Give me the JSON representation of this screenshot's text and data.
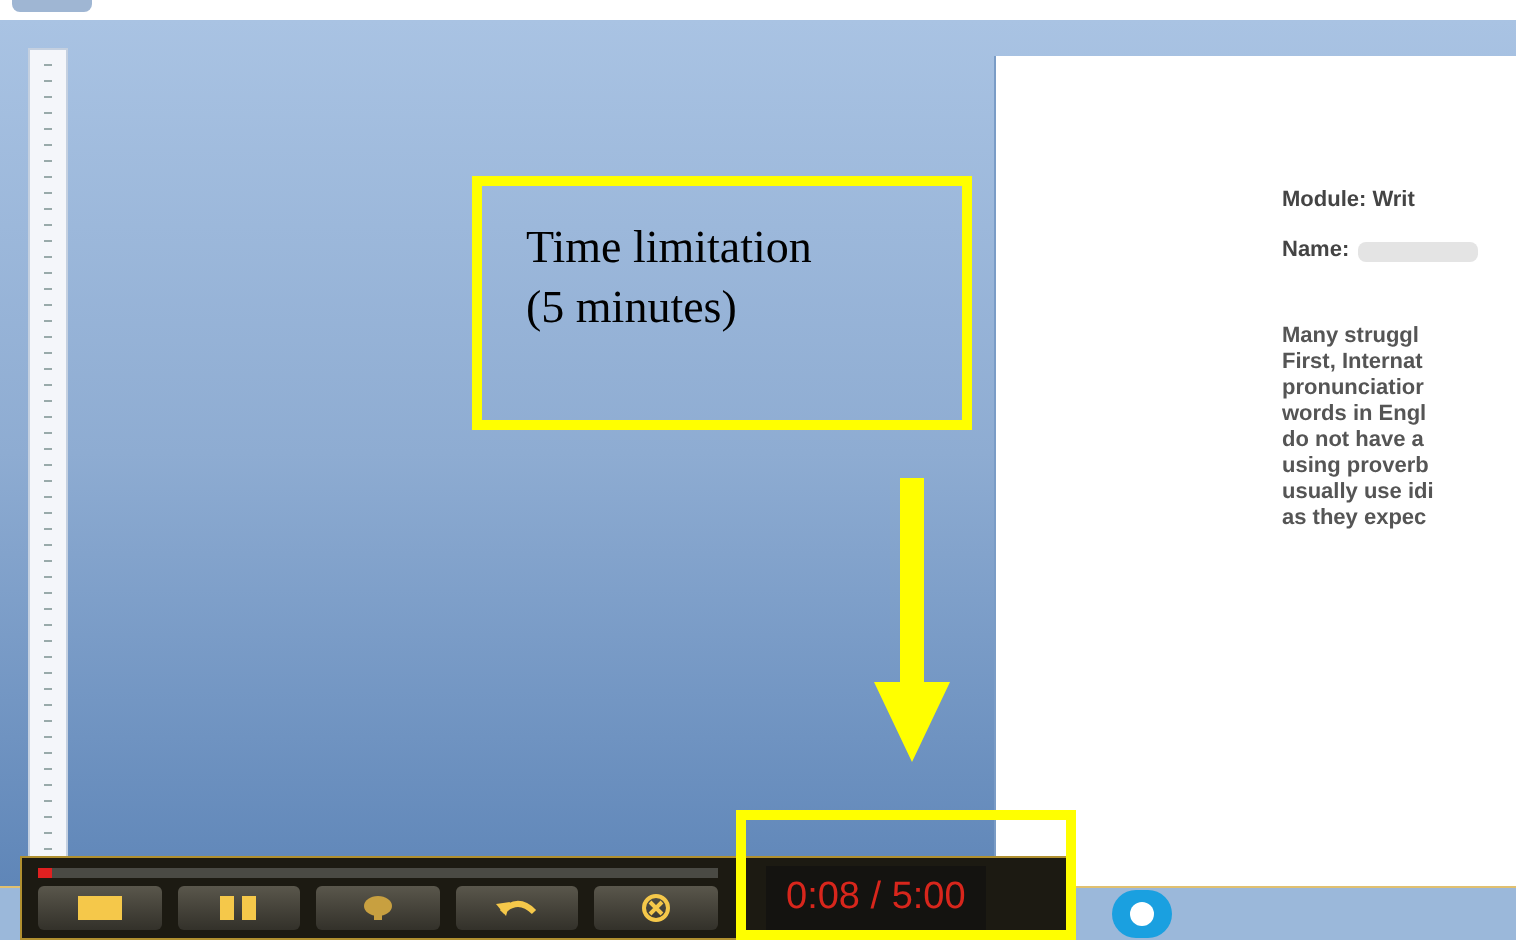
{
  "annotation": {
    "lines": [
      "Time limitation",
      "(5 minutes)"
    ]
  },
  "document": {
    "heading": "Module: Writ",
    "name_label": "Name:",
    "paragraph": [
      "Many struggl",
      "First, Internat",
      "pronunciatior",
      "words in Engl",
      "do not have a",
      "using proverb",
      "usually use idi",
      "as they expec"
    ]
  },
  "recorder": {
    "level": 0.02,
    "buttons": [
      {
        "kind": "stop"
      },
      {
        "kind": "pause"
      },
      {
        "kind": "mic"
      },
      {
        "kind": "undo"
      },
      {
        "kind": "cancel"
      }
    ],
    "timer": "0:08 / 5:00"
  }
}
